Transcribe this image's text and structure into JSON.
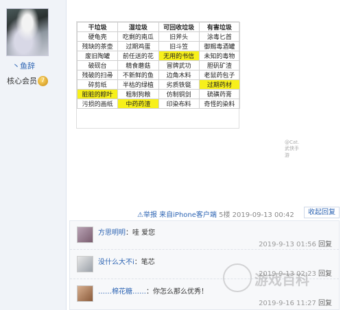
{
  "user": {
    "name": "丶鱼辞",
    "level": "核心会员",
    "level_badge": "7"
  },
  "garbage_table": {
    "headers": [
      "干垃圾",
      "湿垃圾",
      "可回收垃圾",
      "有害垃圾"
    ],
    "rows": [
      [
        "硬龟壳",
        "吃剩的南瓜",
        "旧斧头",
        "涂毒匕首"
      ],
      [
        "残缺的茶壶",
        "过期鸡蛋",
        "旧斗笠",
        "御赐毒酒罐"
      ],
      [
        "废旧陶罐",
        "前任送的花",
        "无用的书信",
        "未知的毒物"
      ],
      [
        "破砚台",
        "精食蘑菇",
        "冒牌武功",
        "胆矾矿渣"
      ],
      [
        "残破的扫帚",
        "不新鲜的鱼",
        "边角木料",
        "老鼠药包子"
      ],
      [
        "碎剪纸",
        "半枯的绿植",
        "劣质铁铤",
        "过期药材"
      ],
      [
        "脏脏的粽叶",
        "粗制狗粮",
        "仿制铜剑",
        "硫磺药膏"
      ],
      [
        "污损的画纸",
        "中药药渣",
        "印染布料",
        "奇怪的染料"
      ]
    ],
    "highlight_color": "#f7f01a",
    "watermark": "@Cat.武侠手游"
  },
  "floor": {
    "report": "举报",
    "client": "来自iPhone客户端",
    "floor_no": "5楼",
    "timestamp": "2019-09-13 00:42",
    "reply_toggle": "收起回复"
  },
  "comments": [
    {
      "name": "方思明明",
      "text": "：哇 爱您",
      "time": "2019-9-13 01:56",
      "reply": "回复"
    },
    {
      "name": "没什么大不i",
      "text": "：笔芯",
      "time": "2019-9-13 02:23",
      "reply": "回复"
    },
    {
      "name": "……棉花糖……",
      "text": "：你怎么那么优秀！",
      "time": "2019-9-16 11:27",
      "reply": "回复"
    }
  ],
  "watermark": "游戏百科"
}
